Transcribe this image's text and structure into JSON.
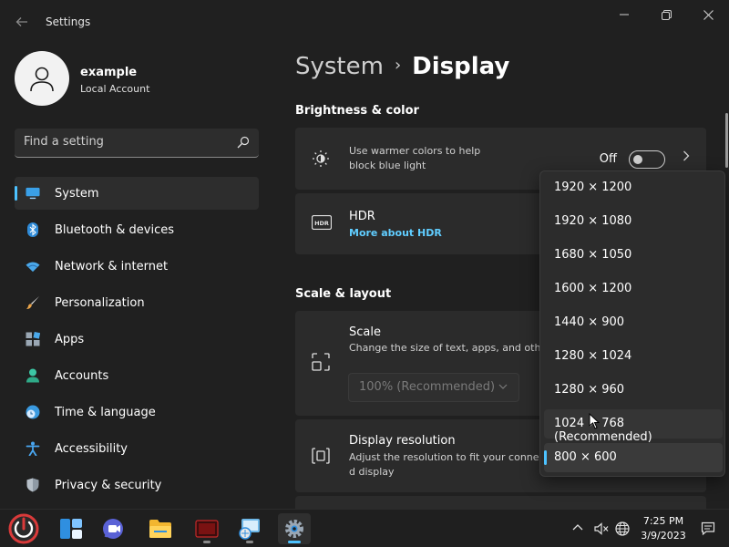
{
  "window": {
    "title": "Settings",
    "back_icon": "back-arrow-icon",
    "controls": [
      "minimize-icon",
      "maximize-icon",
      "close-icon"
    ]
  },
  "account": {
    "name": "example",
    "type": "Local Account",
    "avatar_icon": "user-icon"
  },
  "search": {
    "placeholder": "Find a setting"
  },
  "nav": {
    "items": [
      {
        "label": "System",
        "icon": "monitor-icon",
        "active": true
      },
      {
        "label": "Bluetooth & devices",
        "icon": "bluetooth-icon"
      },
      {
        "label": "Network & internet",
        "icon": "wifi-icon"
      },
      {
        "label": "Personalization",
        "icon": "brush-icon"
      },
      {
        "label": "Apps",
        "icon": "apps-icon"
      },
      {
        "label": "Accounts",
        "icon": "person-icon"
      },
      {
        "label": "Time & language",
        "icon": "globe-clock-icon"
      },
      {
        "label": "Accessibility",
        "icon": "accessibility-icon"
      },
      {
        "label": "Privacy & security",
        "icon": "shield-icon"
      }
    ]
  },
  "breadcrumb": {
    "parent": "System",
    "separator": "›",
    "current": "Display"
  },
  "sections": {
    "brightness": "Brightness & color",
    "scale_layout": "Scale & layout"
  },
  "cards": {
    "night_light": {
      "desc_line1": "Use warmer colors to help",
      "desc_line2": "block blue light",
      "state_label": "Off",
      "toggle_on": false,
      "icon": "brightness-icon"
    },
    "hdr": {
      "title": "HDR",
      "link": "More about HDR",
      "icon": "hdr-icon"
    },
    "scale": {
      "title": "Scale",
      "desc": "Change the size of text, apps, and othe",
      "select_value": "100% (Recommended)",
      "icon": "scale-icon"
    },
    "resolution": {
      "title": "Display resolution",
      "desc_line1": "Adjust the resolution to fit your conne",
      "desc_line2": "d display",
      "icon": "resolution-icon"
    }
  },
  "resolution_dropdown": {
    "options": [
      "1920 × 1200",
      "1920 × 1080",
      "1680 × 1050",
      "1600 × 1200",
      "1440 × 900",
      "1280 × 1024",
      "1280 × 960",
      "1024 × 768 (Recommended)",
      "800 × 600"
    ],
    "selected_index": 8,
    "hover_index": 7
  },
  "taskbar": {
    "apps": [
      "power-icon",
      "widgets-icon",
      "chat-icon",
      "file-explorer-icon",
      "terminal-icon",
      "network-app-icon",
      "settings-icon"
    ],
    "tray_icons": [
      "chevron-up-icon",
      "speaker-muted-icon",
      "globe-icon"
    ],
    "time": "7:25 PM",
    "date": "3/9/2023",
    "notification_icon": "notification-icon"
  },
  "colors": {
    "accent": "#4cc2ff",
    "link": "#60cdff",
    "background": "#202020",
    "card": "#2b2b2b"
  }
}
